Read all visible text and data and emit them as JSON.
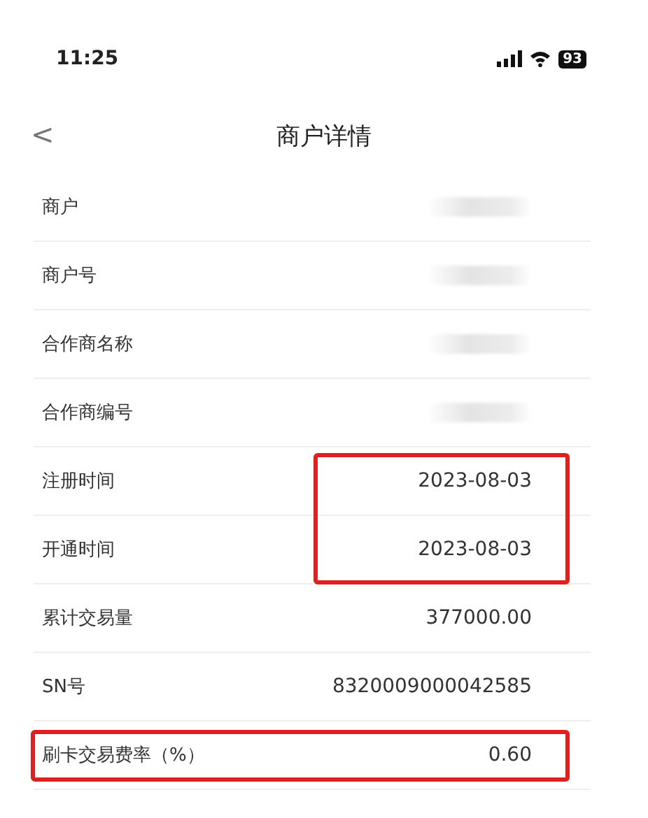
{
  "status_bar": {
    "time": "11:25",
    "battery": "93"
  },
  "nav": {
    "title": "商户详情",
    "back": "<"
  },
  "rows": [
    {
      "label": "商户",
      "redacted": true,
      "value_framed": false,
      "row_framed": false
    },
    {
      "label": "商户号",
      "redacted": true,
      "value_framed": false,
      "row_framed": false
    },
    {
      "label": "合作商名称",
      "redacted": true,
      "value_framed": false,
      "row_framed": false
    },
    {
      "label": "合作商编号",
      "redacted": true,
      "value_framed": false,
      "row_framed": false
    },
    {
      "label": "注册时间",
      "value": "2023-08-03",
      "redacted": false,
      "value_framed": true,
      "row_framed": false
    },
    {
      "label": "开通时间",
      "value": "2023-08-03",
      "redacted": false,
      "value_framed": true,
      "row_framed": false
    },
    {
      "label": "累计交易量",
      "value": "377000.00",
      "redacted": false,
      "value_framed": false,
      "row_framed": false
    },
    {
      "label": "SN号",
      "value": "8320009000042585",
      "redacted": false,
      "value_framed": false,
      "row_framed": false
    },
    {
      "label": "刷卡交易费率（%）",
      "value": "0.60",
      "redacted": false,
      "value_framed": false,
      "row_framed": true
    }
  ]
}
